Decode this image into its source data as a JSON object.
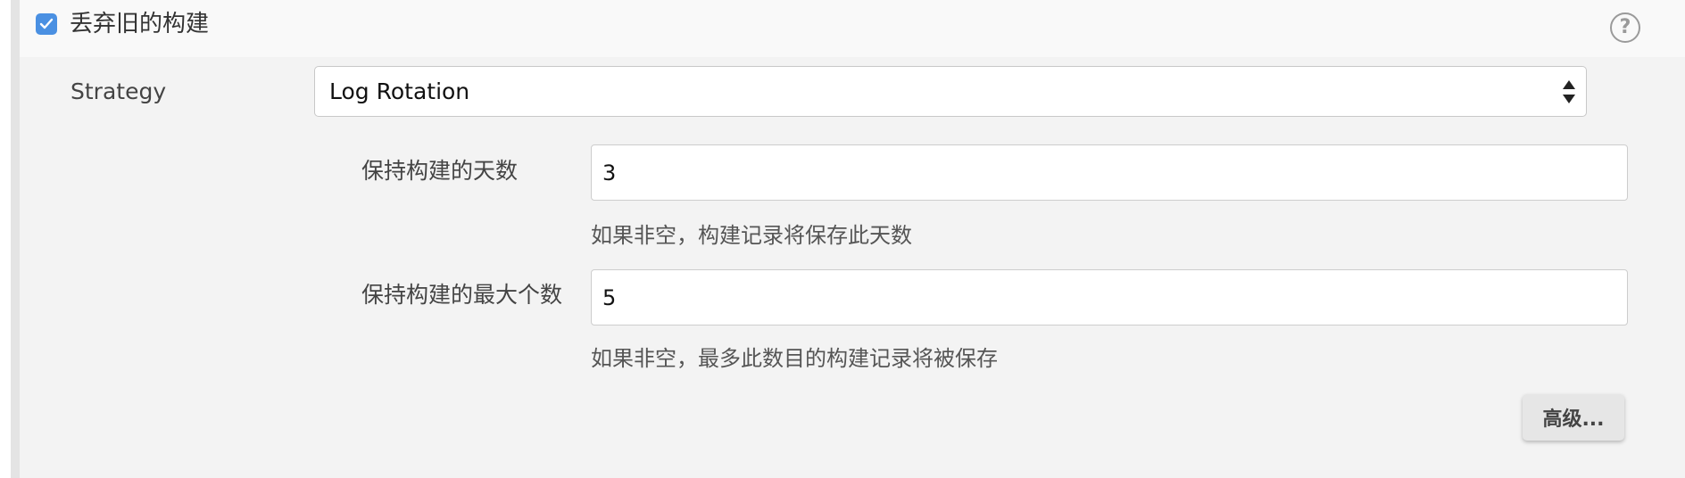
{
  "section": {
    "enabled": true,
    "title": "丢弃旧的构建",
    "help_icon": "question-circle-icon"
  },
  "strategy": {
    "label": "Strategy",
    "selected": "Log Rotation"
  },
  "fields": {
    "days": {
      "label": "保持构建的天数",
      "value": "3",
      "hint": "如果非空，构建记录将保存此天数"
    },
    "max_count": {
      "label": "保持构建的最大个数",
      "value": "5",
      "hint": "如果非空，最多此数目的构建记录将被保存"
    }
  },
  "advanced_button": "高级...",
  "colors": {
    "checkbox": "#4a90e2",
    "panel_bg": "#f3f3f3",
    "header_bg": "#f9f9f9"
  }
}
